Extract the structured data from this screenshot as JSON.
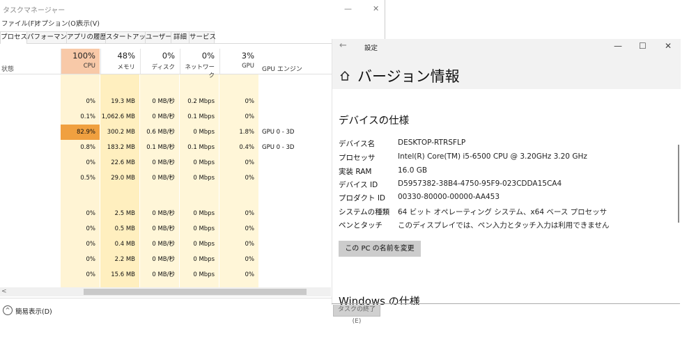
{
  "taskmgr": {
    "title": "タスクマネージャー",
    "menu": [
      "ファイル(F)",
      "オプション(O)",
      "表示(V)"
    ],
    "tabs": [
      "プロセス",
      "パフォーマンス",
      "アプリの履歴",
      "スタートアップ",
      "ユーザー",
      "詳細",
      "サービス"
    ],
    "header": {
      "status": "状態",
      "cpu_pct": "100%",
      "cpu": "CPU",
      "mem_pct": "48%",
      "mem": "メモリ",
      "disk_pct": "0%",
      "disk": "ディスク",
      "net_pct": "0%",
      "net": "ネットワーク",
      "gpu_pct": "3%",
      "gpu": "GPU",
      "gpu_engine": "GPU エンジン"
    },
    "rows": [
      {
        "cpu": "0%",
        "mem": "19.3 MB",
        "disk": "0 MB/秒",
        "net": "0.2 Mbps",
        "gpu": "0%",
        "eng": ""
      },
      {
        "cpu": "0.1%",
        "mem": "1,062.6 MB",
        "disk": "0 MB/秒",
        "net": "0.1 Mbps",
        "gpu": "0%",
        "eng": ""
      },
      {
        "cpu": "82.9%",
        "mem": "300.2 MB",
        "disk": "0.6 MB/秒",
        "net": "0 Mbps",
        "gpu": "1.8%",
        "eng": "GPU 0 - 3D"
      },
      {
        "cpu": "0.8%",
        "mem": "183.2 MB",
        "disk": "0.1 MB/秒",
        "net": "0.1 Mbps",
        "gpu": "0.4%",
        "eng": "GPU 0 - 3D"
      },
      {
        "cpu": "0%",
        "mem": "22.6 MB",
        "disk": "0 MB/秒",
        "net": "0 Mbps",
        "gpu": "0%",
        "eng": ""
      },
      {
        "cpu": "0.5%",
        "mem": "29.0 MB",
        "disk": "0 MB/秒",
        "net": "0 Mbps",
        "gpu": "0%",
        "eng": ""
      },
      {
        "cpu": "0%",
        "mem": "2.5 MB",
        "disk": "0 MB/秒",
        "net": "0 Mbps",
        "gpu": "0%",
        "eng": ""
      },
      {
        "cpu": "0%",
        "mem": "0.5 MB",
        "disk": "0 MB/秒",
        "net": "0 Mbps",
        "gpu": "0%",
        "eng": ""
      },
      {
        "cpu": "0%",
        "mem": "0.4 MB",
        "disk": "0 MB/秒",
        "net": "0 Mbps",
        "gpu": "0%",
        "eng": ""
      },
      {
        "cpu": "0%",
        "mem": "2.2 MB",
        "disk": "0 MB/秒",
        "net": "0 Mbps",
        "gpu": "0%",
        "eng": ""
      },
      {
        "cpu": "0%",
        "mem": "15.6 MB",
        "disk": "0 MB/秒",
        "net": "0 Mbps",
        "gpu": "0%",
        "eng": ""
      }
    ],
    "simple_view": "簡易表示(D)",
    "end_task": "タスクの終了(E)",
    "colors": {
      "cpu_header": "#f8c9a8",
      "cpu_hot": "#f0a040",
      "col_light": "#fff6d8",
      "col_mid": "#ffefc0"
    }
  },
  "settings": {
    "app_title": "設定",
    "page_title": "バージョン情報",
    "section": "デバイスの仕様",
    "specs": [
      {
        "label": "デバイス名",
        "value": "DESKTOP-RTRSFLP"
      },
      {
        "label": "プロセッサ",
        "value": "Intel(R) Core(TM) i5-6500 CPU @ 3.20GHz   3.20 GHz"
      },
      {
        "label": "実装 RAM",
        "value": "16.0 GB"
      },
      {
        "label": "デバイス ID",
        "value": "D5957382-38B4-4750-95F9-023CDDA15CA4"
      },
      {
        "label": "プロダクト ID",
        "value": "00330-80000-00000-AA453"
      },
      {
        "label": "システムの種類",
        "value": "64 ビット オペレーティング システム、x64 ベース プロセッサ"
      },
      {
        "label": "ペンとタッチ",
        "value": "このディスプレイでは、ペン入力とタッチ入力は利用できません"
      }
    ],
    "rename_button": "この PC の名前を変更",
    "section2": "Windows の仕様"
  }
}
